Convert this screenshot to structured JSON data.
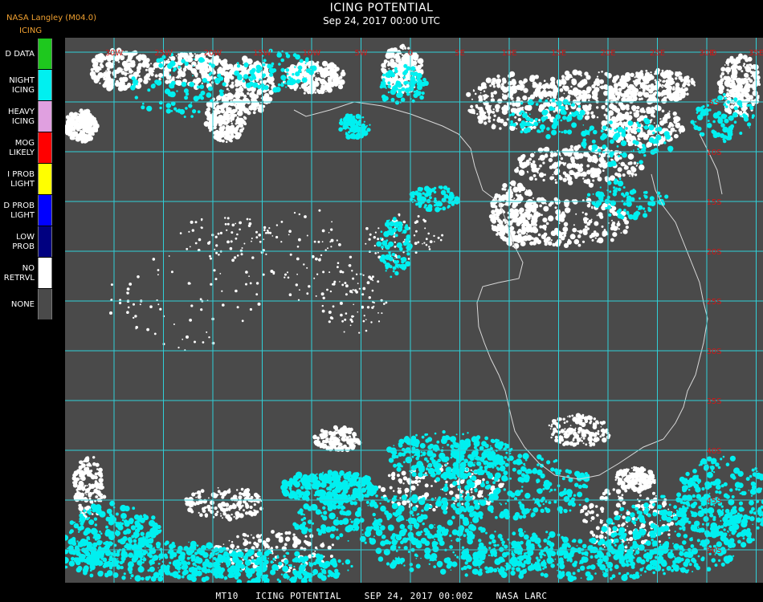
{
  "header": {
    "title": "ICING POTENTIAL",
    "subtitle": "Sep 24, 2017 00:00 UTC",
    "credit": "NASA Langley (M04.0)",
    "product": "ICING"
  },
  "legend": [
    {
      "label": "D DATA",
      "color": "#1ec81e"
    },
    {
      "label": "NIGHT\nICING",
      "color": "#00f0f0"
    },
    {
      "label": "HEAVY\nICING",
      "color": "#e0a0e0"
    },
    {
      "label": "MOG\nLIKELY",
      "color": "#ff0000"
    },
    {
      "label": "I PROB\nLIGHT",
      "color": "#ffff00"
    },
    {
      "label": "D PROB\nLIGHT",
      "color": "#0000ff"
    },
    {
      "label": "LOW\nPROB",
      "color": "#000080"
    },
    {
      "label": "NO\nRETRVL",
      "color": "#ffffff"
    },
    {
      "label": "NONE",
      "color": "#4a4a4a"
    }
  ],
  "map": {
    "background": "#4a4a4a",
    "grid_color": "#30d0d8",
    "label_color": "#d01818",
    "coast_color": "#d8d8d8",
    "top_labels": [
      "30W",
      "25W",
      "20W",
      "15W",
      "10W",
      "5W",
      "0",
      "5E",
      "10E",
      "15E",
      "20E",
      "25E",
      "30E",
      "35E"
    ],
    "right_labels": [
      "0",
      "5S",
      "10S",
      "15S",
      "20S",
      "25S",
      "30S",
      "35S",
      "40S",
      "45S",
      "50S"
    ]
  },
  "footer": "MT10   ICING POTENTIAL    SEP 24, 2017 00:00Z    NASA LARC"
}
